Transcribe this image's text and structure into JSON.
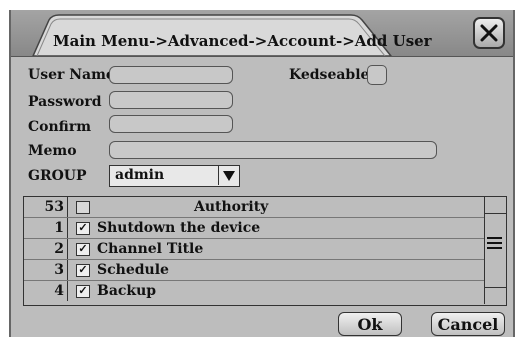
{
  "dialog": {
    "title": "Main Menu->Advanced->Account->Add User",
    "close_icon": "close-x-icon"
  },
  "form": {
    "user_name_label": "User Name",
    "user_name_value": "",
    "kedseable_label": "Kedseable",
    "kedseable_checked": false,
    "password_label": "Password",
    "password_value": "",
    "confirm_label": "Confirm",
    "confirm_value": "",
    "memo_label": "Memo",
    "memo_value": "",
    "group_label": "GROUP",
    "group_value": "admin"
  },
  "authority_table": {
    "header_count": "53",
    "header_label": "Authority",
    "rows": [
      {
        "num": "1",
        "checked": true,
        "label": "Shutdown the device"
      },
      {
        "num": "2",
        "checked": true,
        "label": "Channel Title"
      },
      {
        "num": "3",
        "checked": true,
        "label": "Schedule"
      },
      {
        "num": "4",
        "checked": true,
        "label": "Backup"
      }
    ]
  },
  "buttons": {
    "ok_label": "Ok",
    "cancel_label": "Cancel"
  }
}
